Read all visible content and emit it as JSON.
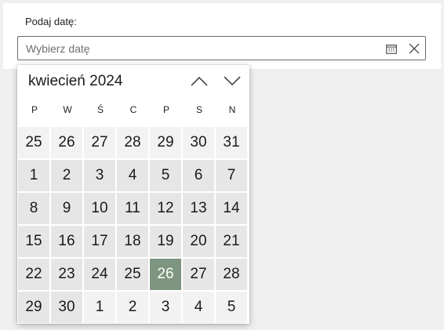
{
  "form": {
    "label": "Podaj datę:",
    "input_placeholder": "Wybierz datę",
    "calendar_icon": "calendar-icon",
    "clear_icon": "close-icon"
  },
  "picker": {
    "month_title": "kwiecień 2024",
    "prev_icon": "chevron-up-icon",
    "next_icon": "chevron-down-icon",
    "weekdays": [
      "P",
      "W",
      "Ś",
      "C",
      "P",
      "S",
      "N"
    ],
    "weeks": [
      [
        {
          "d": "25",
          "m": "prev"
        },
        {
          "d": "26",
          "m": "prev"
        },
        {
          "d": "27",
          "m": "prev"
        },
        {
          "d": "28",
          "m": "prev"
        },
        {
          "d": "29",
          "m": "prev"
        },
        {
          "d": "30",
          "m": "prev"
        },
        {
          "d": "31",
          "m": "prev"
        }
      ],
      [
        {
          "d": "1",
          "m": "cur"
        },
        {
          "d": "2",
          "m": "cur"
        },
        {
          "d": "3",
          "m": "cur"
        },
        {
          "d": "4",
          "m": "cur"
        },
        {
          "d": "5",
          "m": "cur"
        },
        {
          "d": "6",
          "m": "cur"
        },
        {
          "d": "7",
          "m": "cur"
        }
      ],
      [
        {
          "d": "8",
          "m": "cur"
        },
        {
          "d": "9",
          "m": "cur"
        },
        {
          "d": "10",
          "m": "cur"
        },
        {
          "d": "11",
          "m": "cur"
        },
        {
          "d": "12",
          "m": "cur"
        },
        {
          "d": "13",
          "m": "cur"
        },
        {
          "d": "14",
          "m": "cur"
        }
      ],
      [
        {
          "d": "15",
          "m": "cur"
        },
        {
          "d": "16",
          "m": "cur"
        },
        {
          "d": "17",
          "m": "cur"
        },
        {
          "d": "18",
          "m": "cur"
        },
        {
          "d": "19",
          "m": "cur"
        },
        {
          "d": "20",
          "m": "cur"
        },
        {
          "d": "21",
          "m": "cur"
        }
      ],
      [
        {
          "d": "22",
          "m": "cur"
        },
        {
          "d": "23",
          "m": "cur"
        },
        {
          "d": "24",
          "m": "cur"
        },
        {
          "d": "25",
          "m": "cur"
        },
        {
          "d": "26",
          "m": "cur",
          "selected": true
        },
        {
          "d": "27",
          "m": "cur"
        },
        {
          "d": "28",
          "m": "cur"
        }
      ],
      [
        {
          "d": "29",
          "m": "cur"
        },
        {
          "d": "30",
          "m": "cur"
        },
        {
          "d": "1",
          "m": "next"
        },
        {
          "d": "2",
          "m": "next"
        },
        {
          "d": "3",
          "m": "next"
        },
        {
          "d": "4",
          "m": "next"
        },
        {
          "d": "5",
          "m": "next"
        }
      ]
    ]
  },
  "colors": {
    "selected": "#7e9580",
    "in_month": "#e6e6e6",
    "out_month": "#f2f2f2"
  }
}
